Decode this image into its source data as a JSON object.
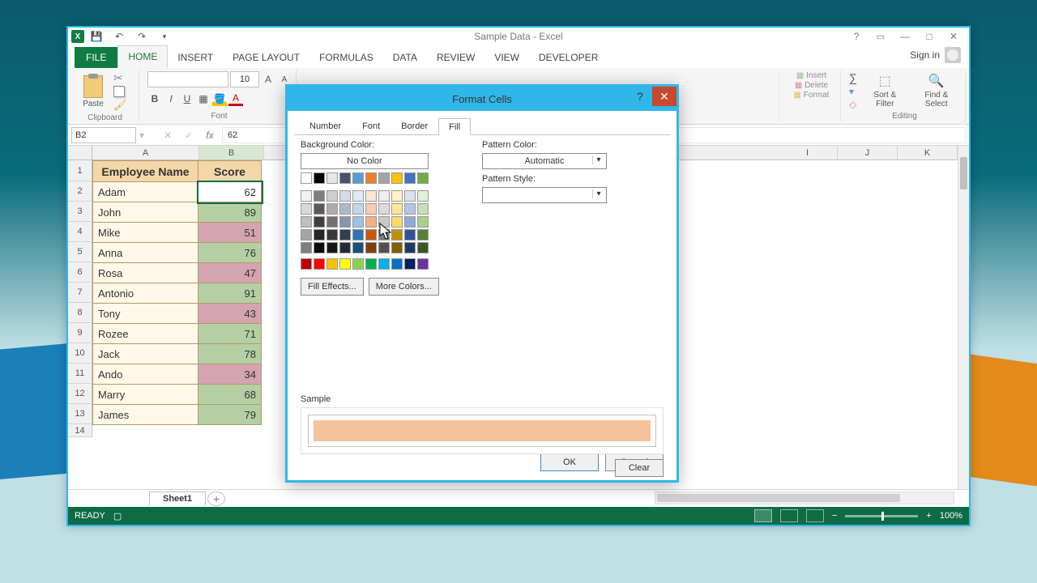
{
  "window": {
    "title": "Sample Data - Excel",
    "sign_in": "Sign in"
  },
  "ribbon": {
    "tabs": [
      "FILE",
      "HOME",
      "INSERT",
      "PAGE LAYOUT",
      "FORMULAS",
      "DATA",
      "REVIEW",
      "VIEW",
      "DEVELOPER"
    ],
    "active_tab": "HOME",
    "groups": {
      "clipboard": "Clipboard",
      "font": "Font",
      "editing": "Editing"
    },
    "paste": "Paste",
    "font_name": "",
    "font_size": "10",
    "insert": "Insert",
    "sort_filter": "Sort & Filter",
    "find_select": "Find & Select"
  },
  "formula_bar": {
    "name_box": "B2",
    "formula": "62"
  },
  "columns": [
    "A",
    "B",
    "I",
    "J",
    "K"
  ],
  "table": {
    "headers": [
      "Employee Name",
      "Score"
    ],
    "rows": [
      {
        "n": 2,
        "name": "Adam",
        "score": 62,
        "cls": "sel"
      },
      {
        "n": 3,
        "name": "John",
        "score": 89,
        "cls": "green"
      },
      {
        "n": 4,
        "name": "Mike",
        "score": 51,
        "cls": "red"
      },
      {
        "n": 5,
        "name": "Anna",
        "score": 76,
        "cls": "green"
      },
      {
        "n": 6,
        "name": "Rosa",
        "score": 47,
        "cls": "red"
      },
      {
        "n": 7,
        "name": "Antonio",
        "score": 91,
        "cls": "green"
      },
      {
        "n": 8,
        "name": "Tony",
        "score": 43,
        "cls": "red"
      },
      {
        "n": 9,
        "name": "Rozee",
        "score": 71,
        "cls": "green"
      },
      {
        "n": 10,
        "name": "Jack",
        "score": 78,
        "cls": "green"
      },
      {
        "n": 11,
        "name": "Ando",
        "score": 34,
        "cls": "red"
      },
      {
        "n": 12,
        "name": "Marry",
        "score": 68,
        "cls": "green"
      },
      {
        "n": 13,
        "name": "James",
        "score": 79,
        "cls": "green"
      }
    ]
  },
  "sheet_tab": "Sheet1",
  "status": {
    "ready": "READY",
    "zoom": "100%"
  },
  "dialog": {
    "title": "Format Cells",
    "tabs": [
      "Number",
      "Font",
      "Border",
      "Fill"
    ],
    "active_tab": "Fill",
    "bg_label": "Background Color:",
    "no_color": "No Color",
    "pattern_color_label": "Pattern Color:",
    "pattern_color_value": "Automatic",
    "pattern_style_label": "Pattern Style:",
    "fill_effects": "Fill Effects...",
    "more_colors": "More Colors...",
    "sample": "Sample",
    "sample_color": "#f4c39a",
    "clear": "Clear",
    "ok": "OK",
    "cancel": "Cancel",
    "theme_row1": [
      "#ffffff",
      "#000000",
      "#e7e6e6",
      "#44546a",
      "#5b9bd5",
      "#ed7d31",
      "#a5a5a5",
      "#ffc000",
      "#4472c4",
      "#70ad47"
    ],
    "tints": [
      [
        "#f2f2f2",
        "#7f7f7f",
        "#d0cece",
        "#d6dce4",
        "#deebf6",
        "#fbe5d5",
        "#ededed",
        "#fff2cc",
        "#d9e2f3",
        "#e2efd9"
      ],
      [
        "#d8d8d8",
        "#595959",
        "#aeabab",
        "#adb9ca",
        "#bdd7ee",
        "#f7cbac",
        "#dbdbdb",
        "#fee599",
        "#b4c6e7",
        "#c5e0b3"
      ],
      [
        "#bfbfbf",
        "#3f3f3f",
        "#757070",
        "#8496b0",
        "#9cc3e5",
        "#f4b183",
        "#c9c9c9",
        "#ffd965",
        "#8eaadb",
        "#a8d08d"
      ],
      [
        "#a5a5a5",
        "#262626",
        "#3a3838",
        "#323f4f",
        "#2e75b5",
        "#c55a11",
        "#7b7b7b",
        "#bf9000",
        "#2f5496",
        "#538135"
      ],
      [
        "#7f7f7f",
        "#0c0c0c",
        "#171616",
        "#222a35",
        "#1e4e79",
        "#833c0b",
        "#525252",
        "#7f6000",
        "#1f3864",
        "#375623"
      ]
    ],
    "standard": [
      "#c00000",
      "#ff0000",
      "#ffc000",
      "#ffff00",
      "#92d050",
      "#00b050",
      "#00b0f0",
      "#0070c0",
      "#002060",
      "#7030a0"
    ]
  }
}
